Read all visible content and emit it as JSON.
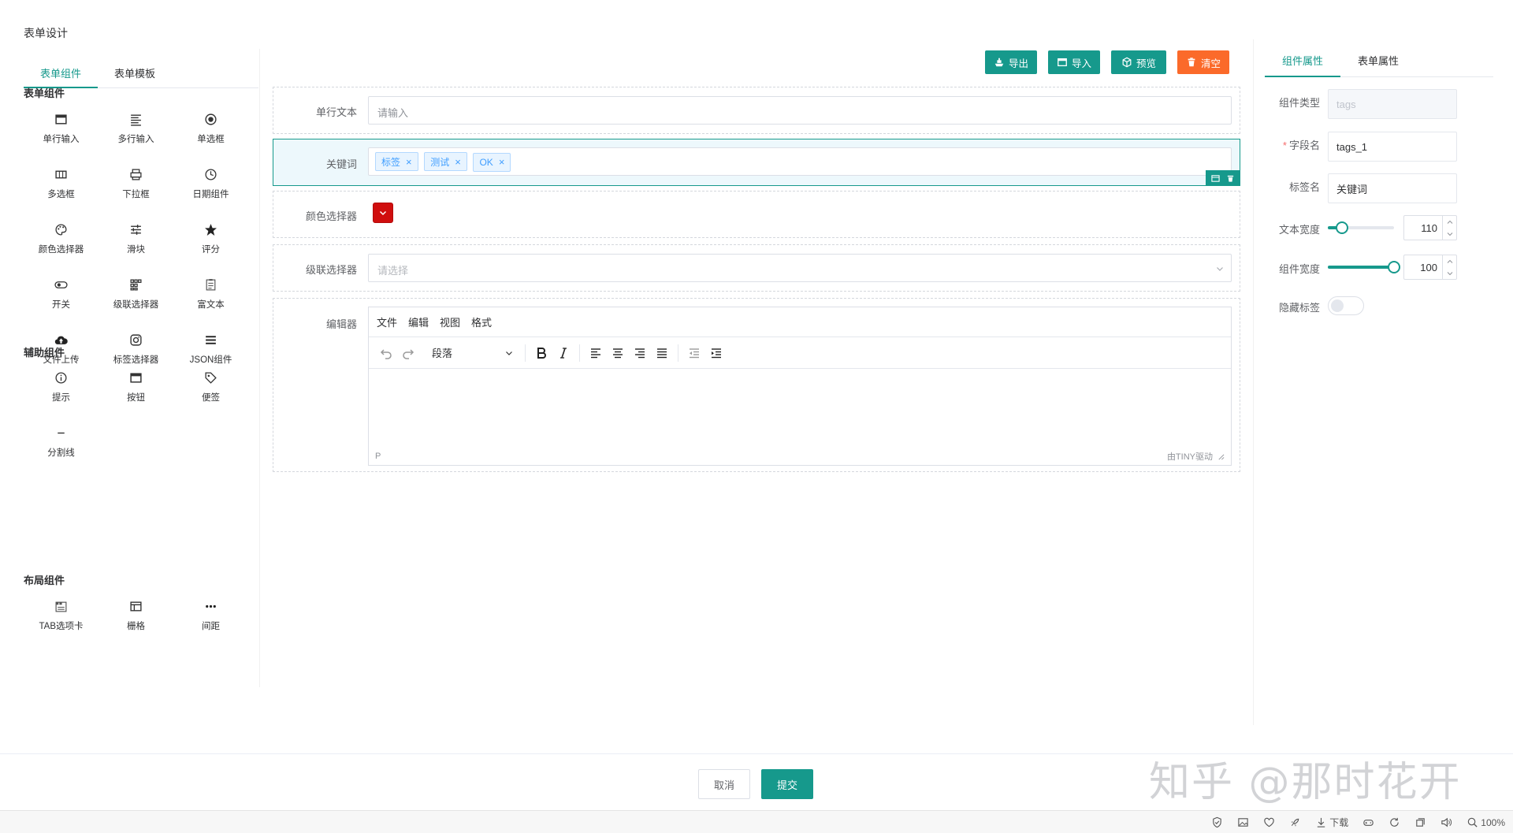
{
  "page": {
    "title": "表单设计"
  },
  "left": {
    "tabs": [
      {
        "label": "表单组件"
      },
      {
        "label": "表单模板"
      }
    ],
    "groups": {
      "form": {
        "title": "表单组件",
        "items": [
          {
            "label": "单行输入",
            "icon": "input-icon"
          },
          {
            "label": "多行输入",
            "icon": "textarea-icon"
          },
          {
            "label": "单选框",
            "icon": "radio-icon"
          },
          {
            "label": "多选框",
            "icon": "checkbox-icon"
          },
          {
            "label": "下拉框",
            "icon": "select-icon"
          },
          {
            "label": "日期组件",
            "icon": "clock-icon"
          },
          {
            "label": "颜色选择器",
            "icon": "palette-icon"
          },
          {
            "label": "滑块",
            "icon": "slider-icon"
          },
          {
            "label": "评分",
            "icon": "star-icon"
          },
          {
            "label": "开关",
            "icon": "switch-icon"
          },
          {
            "label": "级联选择器",
            "icon": "cascader-icon"
          },
          {
            "label": "富文本",
            "icon": "richtext-icon"
          },
          {
            "label": "文件上传",
            "icon": "upload-icon"
          },
          {
            "label": "标签选择器",
            "icon": "tag-select-icon"
          },
          {
            "label": "JSON组件",
            "icon": "json-icon"
          }
        ]
      },
      "aux": {
        "title": "辅助组件",
        "items": [
          {
            "label": "提示",
            "icon": "info-icon"
          },
          {
            "label": "按钮",
            "icon": "button-icon"
          },
          {
            "label": "便签",
            "icon": "tag-icon"
          },
          {
            "label": "分割线",
            "icon": "divider-icon"
          }
        ]
      },
      "layout": {
        "title": "布局组件",
        "items": [
          {
            "label": "TAB选项卡",
            "icon": "tabs-icon"
          },
          {
            "label": "栅格",
            "icon": "grid-icon"
          },
          {
            "label": "间距",
            "icon": "more-icon"
          }
        ]
      }
    }
  },
  "toolbar": {
    "export": "导出",
    "import": "导入",
    "preview": "预览",
    "clear": "清空"
  },
  "canvas": {
    "single": {
      "label": "单行文本",
      "placeholder": "请输入"
    },
    "keywords": {
      "label": "关键词",
      "tags": [
        "标签",
        "测试",
        "OK"
      ]
    },
    "color": {
      "label": "颜色选择器",
      "value": "#d00e0e"
    },
    "cascader": {
      "label": "级联选择器",
      "placeholder": "请选择"
    },
    "editor": {
      "label": "编辑器",
      "menus": [
        "文件",
        "编辑",
        "视图",
        "格式"
      ],
      "block_format": "段落",
      "status_path": "P",
      "branding": "由TINY驱动"
    }
  },
  "props": {
    "tabs": [
      {
        "label": "组件属性"
      },
      {
        "label": "表单属性"
      }
    ],
    "type": {
      "label": "组件类型",
      "value": "tags"
    },
    "field": {
      "label": "字段名",
      "value": "tags_1"
    },
    "tag_name": {
      "label": "标签名",
      "value": "关键词"
    },
    "text_width": {
      "label": "文本宽度",
      "value": "110",
      "fraction": 0.22
    },
    "comp_width": {
      "label": "组件宽度",
      "value": "100",
      "fraction": 1.0
    },
    "hide_label": {
      "label": "隐藏标签",
      "on": false
    }
  },
  "footer": {
    "cancel": "取消",
    "submit": "提交"
  },
  "watermark": "知乎 @那时花开",
  "statusbar": {
    "download": "下载",
    "zoom": "100%"
  },
  "colors": {
    "accent": "#16998c",
    "danger": "#fb6a2a",
    "tag": "#409eff"
  }
}
